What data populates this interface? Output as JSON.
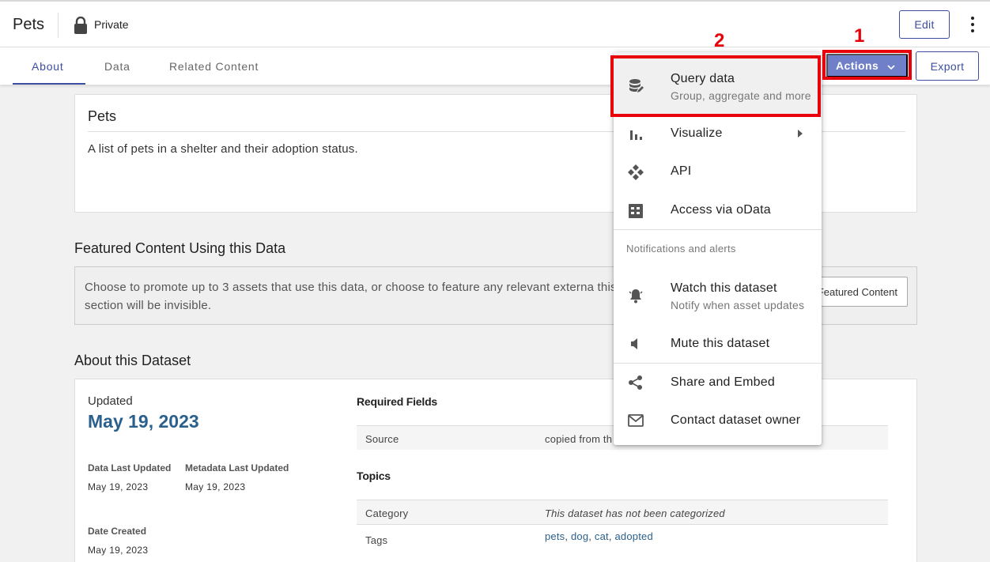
{
  "header": {
    "title": "Pets",
    "visibility": "Private",
    "edit_label": "Edit"
  },
  "tabs": [
    {
      "label": "About",
      "active": true
    },
    {
      "label": "Data",
      "active": false
    },
    {
      "label": "Related Content",
      "active": false
    }
  ],
  "toolbar": {
    "actions_label": "Actions",
    "export_label": "Export"
  },
  "annotations": {
    "one": "1",
    "two": "2",
    "color": "#e8000b"
  },
  "description_card": {
    "title": "Pets",
    "text": "A list of pets in a shelter and their adoption status."
  },
  "featured": {
    "heading": "Featured Content Using this Data",
    "text": "Choose to promote up to 3 assets that use this data, or choose to feature any relevant externa this section will be invisible.",
    "button_label": "Featured Content"
  },
  "about": {
    "heading": "About this Dataset",
    "updated_label": "Updated",
    "updated_value": "May 19, 2023",
    "data_last_updated_label": "Data Last Updated",
    "data_last_updated_value": "May 19, 2023",
    "metadata_last_updated_label": "Metadata Last Updated",
    "metadata_last_updated_value": "May 19, 2023",
    "date_created_label": "Date Created",
    "date_created_value": "May 19, 2023",
    "required_fields_heading": "Required Fields",
    "source_key": "Source",
    "source_value": "copied from th",
    "topics_heading": "Topics",
    "category_key": "Category",
    "category_value": "This dataset has not been categorized",
    "tags_key": "Tags",
    "tags": [
      "pets",
      "dog",
      "cat",
      "adopted"
    ],
    "tag_separator": ","
  },
  "menu": {
    "query_data": {
      "label": "Query data",
      "sub": "Group, aggregate and more",
      "icon": "database-icon"
    },
    "visualize": {
      "label": "Visualize",
      "icon": "bar-chart-icon"
    },
    "api": {
      "label": "API",
      "icon": "api-icon"
    },
    "odata": {
      "label": "Access via oData",
      "icon": "table-icon"
    },
    "section_notifications": "Notifications and alerts",
    "watch": {
      "label": "Watch this dataset",
      "sub": "Notify when asset updates",
      "icon": "bell-icon"
    },
    "mute": {
      "label": "Mute this dataset",
      "icon": "speaker-icon"
    },
    "share": {
      "label": "Share and Embed",
      "icon": "share-icon"
    },
    "contact": {
      "label": "Contact dataset owner",
      "icon": "mail-icon"
    }
  },
  "colors": {
    "primary": "#3d4ea0",
    "actions_bg": "#6f7fc8",
    "link": "#2b5f8c"
  }
}
